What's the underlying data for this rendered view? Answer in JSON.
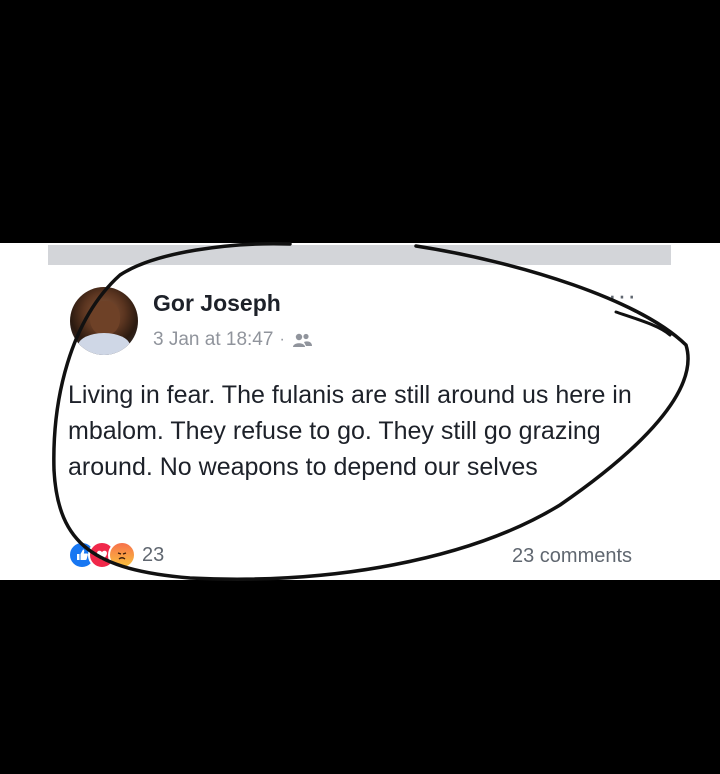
{
  "post": {
    "author": "Gor Joseph",
    "timestamp": "3 Jan at 18:47",
    "separator": "·",
    "audience_icon": "friends-icon",
    "more_label": "···",
    "text": "Living in fear.  The fulanis are still around us here in mbalom.  They refuse to go. They still go grazing around. No weapons to depend our selves"
  },
  "footer": {
    "reaction_icons": [
      "like-icon",
      "love-icon",
      "angry-icon"
    ],
    "reaction_count": "23",
    "comments_label": "23 comments"
  },
  "colors": {
    "background": "#000000",
    "card": "#ffffff",
    "name": "#1d2129",
    "meta": "#90949c",
    "like": "#1877f2",
    "love": "#f0284a"
  }
}
